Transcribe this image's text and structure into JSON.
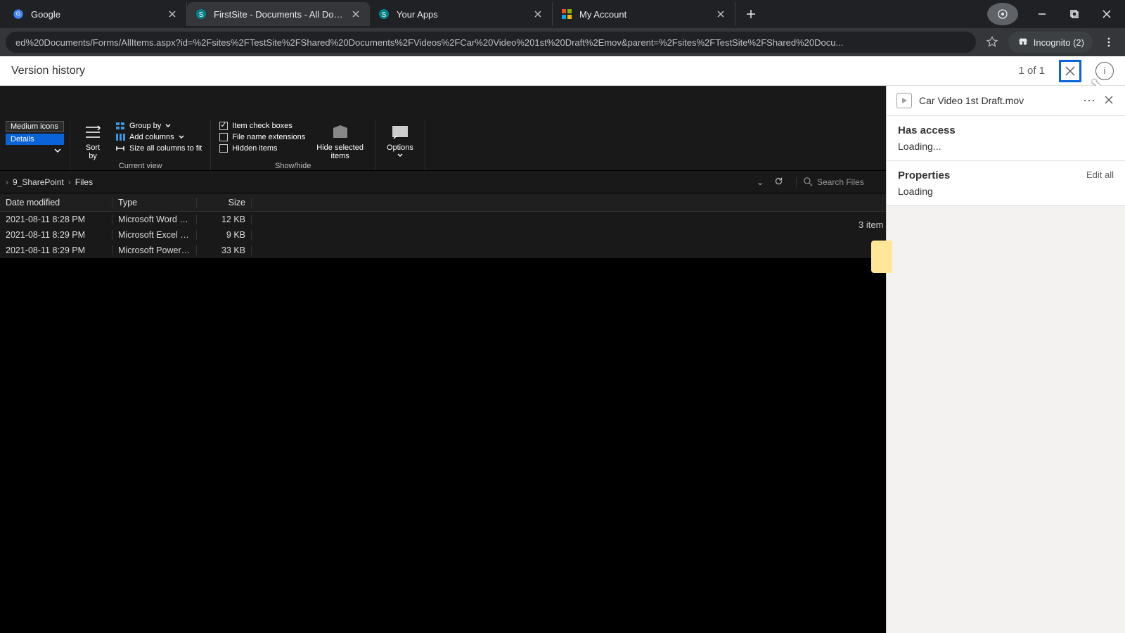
{
  "chrome": {
    "tabs": [
      {
        "label": "Google",
        "icon": "google"
      },
      {
        "label": "FirstSite - Documents - All Docu",
        "icon": "sharepoint"
      },
      {
        "label": "Your Apps",
        "icon": "sharepoint"
      },
      {
        "label": "My Account",
        "icon": "microsoft"
      }
    ],
    "url": "ed%20Documents/Forms/AllItems.aspx?id=%2Fsites%2FTestSite%2FShared%20Documents%2FVideos%2FCar%20Video%201st%20Draft%2Emov&parent=%2Fsites%2FTestSite%2FShared%20Docu...",
    "incognito": "Incognito (2)"
  },
  "sp": {
    "title": "Version history",
    "counter": "1 of 1"
  },
  "ribbon": {
    "layout": {
      "medium": "Medium icons",
      "details": "Details",
      "sort": "Sort\nby",
      "group": "Group by",
      "addcols": "Add columns",
      "fit": "Size all columns to fit",
      "group_label": "Current view"
    },
    "showhide": {
      "checkboxes": "Item check boxes",
      "ext": "File name extensions",
      "hidden": "Hidden items",
      "hidesel": "Hide selected\nitems",
      "group_label": "Show/hide"
    },
    "options": "Options"
  },
  "addr": {
    "crumb1": "9_SharePoint",
    "crumb2": "Files",
    "search_ph": "Search Files"
  },
  "table": {
    "cols": {
      "date": "Date modified",
      "type": "Type",
      "size": "Size"
    },
    "rows": [
      {
        "date": "2021-08-11 8:28 PM",
        "type": "Microsoft Word D...",
        "size": "12 KB"
      },
      {
        "date": "2021-08-11 8:29 PM",
        "type": "Microsoft Excel W...",
        "size": "9 KB"
      },
      {
        "date": "2021-08-11 8:29 PM",
        "type": "Microsoft PowerP...",
        "size": "33 KB"
      }
    ],
    "summary": "3 item"
  },
  "panel": {
    "filename": "Car Video 1st Draft.mov",
    "access_h": "Has access",
    "access_v": "Loading...",
    "props_h": "Properties",
    "props_v": "Loading",
    "edit": "Edit all"
  }
}
